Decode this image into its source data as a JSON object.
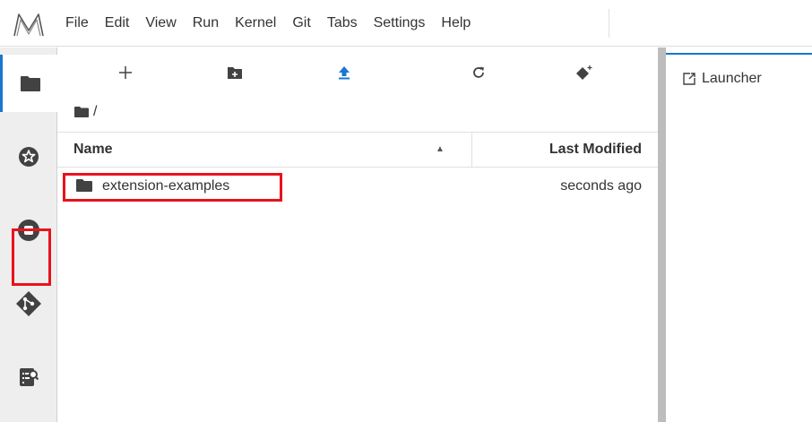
{
  "app": {
    "logo_icon": "jupyter-logo-icon"
  },
  "menubar": {
    "items": [
      "File",
      "Edit",
      "View",
      "Run",
      "Kernel",
      "Git",
      "Tabs",
      "Settings",
      "Help"
    ]
  },
  "activity_bar": {
    "items": [
      {
        "name": "file-browser",
        "icon": "folder-icon",
        "active": true
      },
      {
        "name": "running",
        "icon": "running-icon",
        "active": false
      },
      {
        "name": "stop",
        "icon": "stop-icon",
        "active": false
      },
      {
        "name": "git",
        "icon": "git-icon",
        "active": false,
        "highlighted": true
      },
      {
        "name": "property-inspector",
        "icon": "inspector-icon",
        "active": false
      }
    ]
  },
  "file_browser": {
    "toolbar": {
      "new_launcher": "new-launcher-icon",
      "new_folder": "new-folder-icon",
      "upload": "upload-icon",
      "refresh": "refresh-icon",
      "git_clone": "git-clone-icon"
    },
    "breadcrumb": "/",
    "columns": {
      "name": "Name",
      "modified": "Last Modified"
    },
    "files": [
      {
        "name": "extension-examples",
        "modified": "seconds ago",
        "type": "directory",
        "highlighted": true
      }
    ]
  },
  "main": {
    "tabs": [
      {
        "label": "Launcher",
        "icon": "launcher-icon"
      }
    ]
  },
  "colors": {
    "highlight": "#e8131b",
    "accent": "#1976d2",
    "icon": "#424242",
    "upload": "#1976d2",
    "git": "#424242"
  }
}
